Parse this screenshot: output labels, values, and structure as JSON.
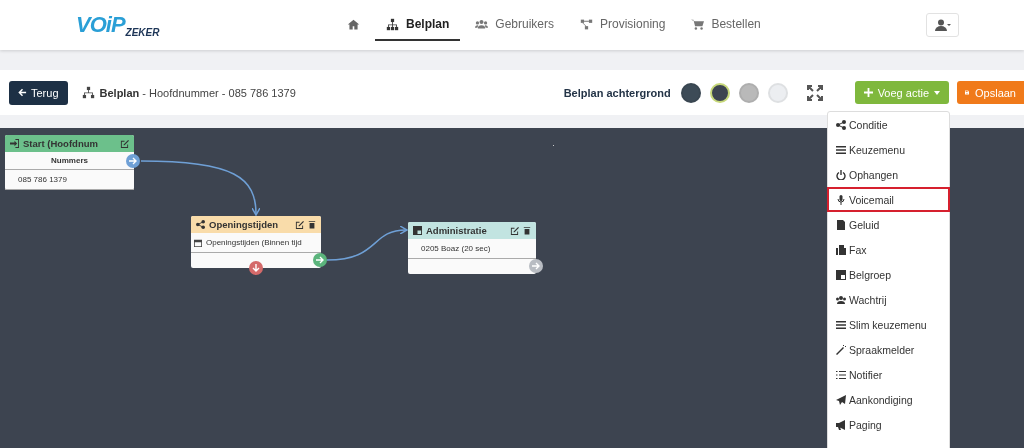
{
  "logo": {
    "main": "VOiP",
    "sub": "ZEKER"
  },
  "nav": [
    {
      "kind": "home",
      "selected": false
    },
    {
      "kind": "sitemap",
      "label": "Belplan",
      "selected": true
    },
    {
      "kind": "users",
      "label": "Gebruikers",
      "selected": false
    },
    {
      "kind": "network",
      "label": "Provisioning",
      "selected": false
    },
    {
      "kind": "cart",
      "label": "Bestellen",
      "selected": false
    }
  ],
  "toolbar": {
    "back": "Terug",
    "title": "Belplan",
    "subtitle": "- Hoofdnummer - 085 786 1379",
    "background_label": "Belplan achtergrond",
    "swatches": [
      {
        "color": "#3d4b57",
        "selected": false
      },
      {
        "color": "#3d4450",
        "selected": true
      },
      {
        "color": "#b9b9b9",
        "selected": false
      },
      {
        "color": "#eceef1",
        "selected": false
      }
    ],
    "add_button": "Voeg actie",
    "save_button": "Opslaan"
  },
  "nodes": [
    {
      "kind": "start",
      "title": "Start (Hoofdnum",
      "header": "Nummers",
      "rows": [
        "085 786 1379"
      ],
      "deletable": false
    },
    {
      "kind": "condition",
      "title": "Openingstijden",
      "rows": [
        "Openingstijden (Binnen tijd"
      ],
      "deletable": true
    },
    {
      "kind": "group",
      "title": "Administratie",
      "rows": [
        "0205 Boaz (20 sec)"
      ],
      "deletable": true
    }
  ],
  "menu": [
    {
      "kind": "share",
      "label": "Conditie",
      "highlighted": false
    },
    {
      "kind": "bars",
      "label": "Keuzemenu",
      "highlighted": false
    },
    {
      "kind": "power",
      "label": "Ophangen",
      "highlighted": false
    },
    {
      "kind": "mic",
      "label": "Voicemail",
      "highlighted": true
    },
    {
      "kind": "file",
      "label": "Geluid",
      "highlighted": false
    },
    {
      "kind": "fax",
      "label": "Fax",
      "highlighted": false
    },
    {
      "kind": "group",
      "label": "Belgroep",
      "highlighted": false
    },
    {
      "kind": "users",
      "label": "Wachtrij",
      "highlighted": false
    },
    {
      "kind": "bars",
      "label": "Slim keuzemenu",
      "highlighted": false
    },
    {
      "kind": "wand",
      "label": "Spraakmelder",
      "highlighted": false
    },
    {
      "kind": "list",
      "label": "Notifier",
      "highlighted": false
    },
    {
      "kind": "plane",
      "label": "Aankondiging",
      "highlighted": false
    },
    {
      "kind": "bullhorn",
      "label": "Paging",
      "highlighted": false
    }
  ]
}
